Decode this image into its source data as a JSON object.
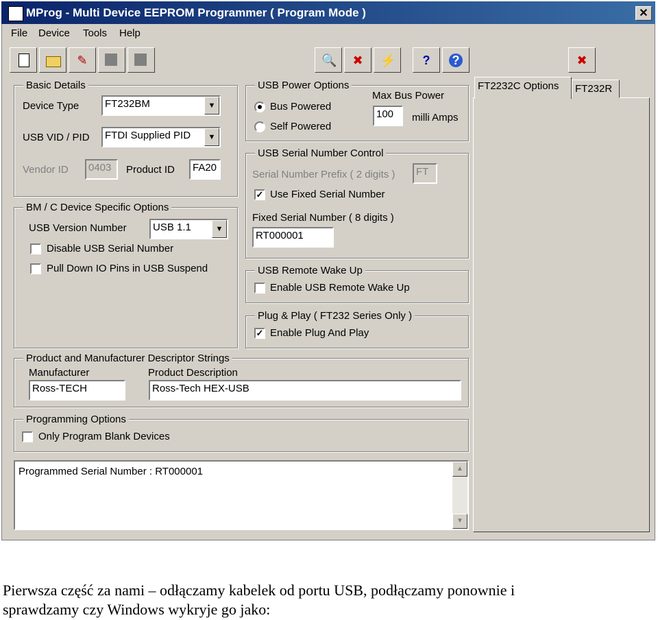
{
  "window": {
    "title": "MProg - Multi Device EEPROM Programmer ( Program Mode )",
    "close": "✕"
  },
  "menu": {
    "file": "File",
    "device": "Device",
    "tools": "Tools",
    "help": "Help"
  },
  "basic": {
    "legend": "Basic Details",
    "device_type_label": "Device Type",
    "device_type_value": "FT232BM",
    "vidpid_label": "USB VID / PID",
    "vidpid_value": "FTDI Supplied PID",
    "vendor_label": "Vendor ID",
    "vendor_value": "0403",
    "product_label": "Product ID",
    "product_value": "FA20"
  },
  "bmc": {
    "legend": "BM / C Device Specific Options",
    "usb_version_label": "USB Version Number",
    "usb_version_value": "USB 1.1",
    "disable_serial": "Disable USB Serial Number",
    "pull_down": "Pull Down IO Pins in USB Suspend"
  },
  "power": {
    "legend": "USB Power Options",
    "bus": "Bus Powered",
    "self": "Self Powered",
    "max_label": "Max Bus Power",
    "max_value": "100",
    "unit": "milli Amps"
  },
  "serial": {
    "legend": "USB Serial Number Control",
    "prefix_label": "Serial Number Prefix ( 2 digits )",
    "prefix_value": "FT",
    "use_fixed": "Use Fixed Serial Number",
    "fixed_label": "Fixed Serial Number ( 8 digits )",
    "fixed_value": "RT000001"
  },
  "wake": {
    "legend": "USB Remote Wake Up",
    "enable": "Enable USB Remote Wake Up"
  },
  "pnp": {
    "legend": "Plug & Play  ( FT232 Series Only )",
    "enable": "Enable Plug And Play"
  },
  "strings": {
    "legend": "Product and Manufacturer Descriptor Strings",
    "manufacturer_label": "Manufacturer",
    "manufacturer_value": "Ross-TECH",
    "product_label": "Product Description",
    "product_value": "Ross-Tech HEX-USB"
  },
  "prog": {
    "legend": "Programming Options",
    "blank": "Only Program Blank Devices"
  },
  "tabs": [
    "FT2232C Options",
    "FT232R"
  ],
  "log": "Programmed Serial Number : RT000001",
  "caption": {
    "line1": "Pierwsza  część  za  nami  –  odłączamy  kabelek  od  portu  USB,  podłączamy  ponownie  i",
    "line2": "sprawdzamy czy Windows wykryje go jako:"
  }
}
